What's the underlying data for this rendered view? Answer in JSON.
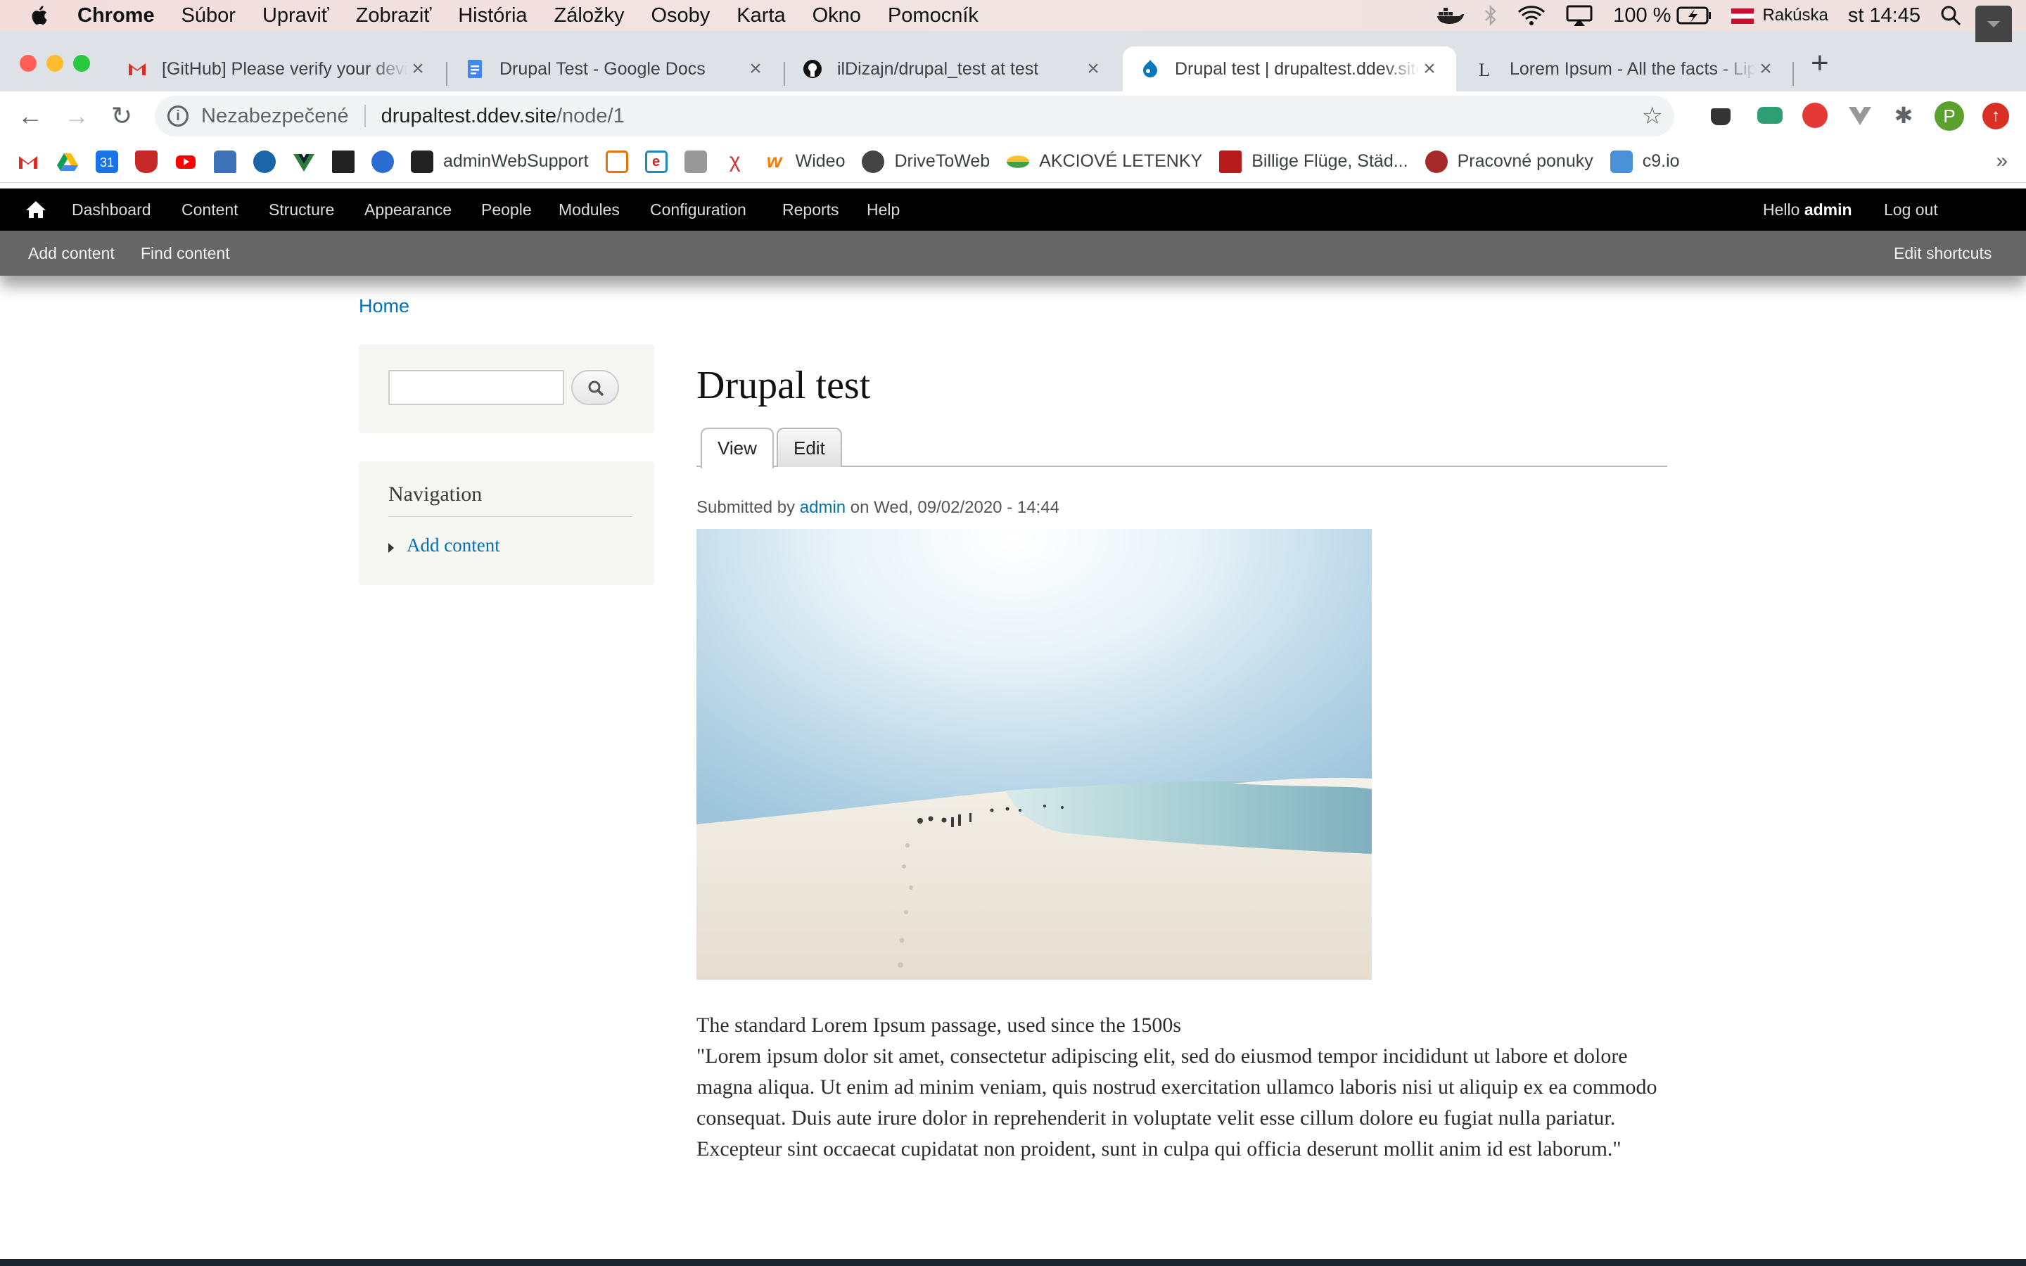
{
  "os_menubar": {
    "app_name": "Chrome",
    "menus": [
      "Súbor",
      "Upraviť",
      "Zobraziť",
      "História",
      "Záložky",
      "Osoby",
      "Karta",
      "Okno",
      "Pomocník"
    ],
    "battery": "100 %",
    "input_source": "Rakúska",
    "clock": "st 14:45"
  },
  "browser": {
    "tabs": [
      {
        "title": "[GitHub] Please verify your device",
        "icon": "gmail-icon"
      },
      {
        "title": "Drupal Test - Google Docs",
        "icon": "google-docs-icon"
      },
      {
        "title": "ilDizajn/drupal_test at test",
        "icon": "github-icon"
      },
      {
        "title": "Drupal test | drupaltest.ddev.site",
        "icon": "drupal-icon",
        "active": true
      },
      {
        "title": "Lorem Ipsum - All the facts - Lipsum generator",
        "icon": "lipsum-icon"
      }
    ],
    "address": {
      "security_label": "Nezabezpečené",
      "host": "drupaltest.ddev.site",
      "path": "/node/1"
    },
    "bookmarks": [
      {
        "label": "",
        "icon": "gmail-icon"
      },
      {
        "label": "",
        "icon": "google-drive-icon"
      },
      {
        "label": "",
        "icon": "google-calendar-icon"
      },
      {
        "label": "",
        "icon": "shield-icon"
      },
      {
        "label": "",
        "icon": "youtube-icon"
      },
      {
        "label": "",
        "icon": "bus-icon"
      },
      {
        "label": "",
        "icon": "drop-icon"
      },
      {
        "label": "",
        "icon": "vue-icon"
      },
      {
        "label": "",
        "icon": "book-icon"
      },
      {
        "label": "",
        "icon": "robot-icon"
      },
      {
        "label": "adminWebSupport",
        "icon": "websupport-icon"
      },
      {
        "label": "",
        "icon": "calendar-icon"
      },
      {
        "label": "",
        "icon": "e-icon"
      },
      {
        "label": "",
        "icon": "apple-icon"
      },
      {
        "label": "",
        "icon": "lambda-icon"
      },
      {
        "label": "Wideo",
        "icon": "wideo-icon"
      },
      {
        "label": "DriveToWeb",
        "icon": "globe-icon"
      },
      {
        "label": "AKCIOVÉ LETENKY",
        "icon": "plane-icon"
      },
      {
        "label": "Billige Flüge, Städ...",
        "icon": "ryanair-icon"
      },
      {
        "label": "Pracovné ponuky",
        "icon": "jobs-icon"
      },
      {
        "label": "c9.io",
        "icon": "cloud9-icon"
      }
    ],
    "bookmarks_overflow": "»",
    "profile_initial": "P"
  },
  "drupal_toolbar": {
    "menu": [
      "Dashboard",
      "Content",
      "Structure",
      "Appearance",
      "People",
      "Modules",
      "Configuration",
      "Reports",
      "Help"
    ],
    "hello_prefix": "Hello ",
    "username": "admin",
    "logout": "Log out",
    "shortcuts": [
      "Add content",
      "Find content"
    ],
    "edit_shortcuts": "Edit shortcuts"
  },
  "page": {
    "breadcrumb": "Home",
    "sidebar": {
      "search_placeholder": "",
      "navigation_title": "Navigation",
      "navigation_items": [
        "Add content"
      ]
    },
    "title": "Drupal test",
    "local_tabs": [
      "View",
      "Edit"
    ],
    "submitted": {
      "prefix": "Submitted by ",
      "author": "admin",
      "date": " on Wed, 09/02/2020 - 14:44"
    },
    "body": {
      "heading": "The standard Lorem Ipsum passage, used since the 1500s",
      "paragraph": "\"Lorem ipsum dolor sit amet, consectetur adipiscing elit, sed do eiusmod tempor incididunt ut labore et dolore magna aliqua. Ut enim ad minim veniam, quis nostrud exercitation ullamco laboris nisi ut aliquip ex ea commodo consequat. Duis aute irure dolor in reprehenderit in voluptate velit esse cillum dolore eu fugiat nulla pariatur. Excepteur sint occaecat cupidatat non proident, sunt in culpa qui officia deserunt mollit anim id est laborum.\""
    }
  },
  "colors": {
    "link": "#0071b3",
    "admin_bar": "#000000",
    "tray": "#666666",
    "sidebar_block": "#f6f6f2"
  }
}
